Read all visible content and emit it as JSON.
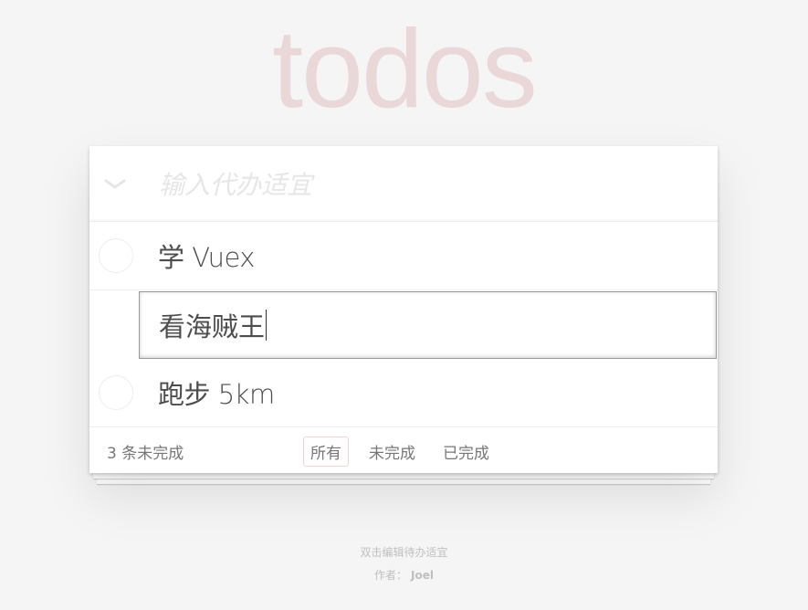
{
  "app": {
    "title": "todos"
  },
  "header": {
    "new_todo_placeholder": "输入代办适宜",
    "toggle_icon": "chevron-down-icon"
  },
  "todos": [
    {
      "title": "学 Vuex",
      "completed": false,
      "editing": false
    },
    {
      "title": "看海贼王",
      "completed": false,
      "editing": true
    },
    {
      "title": "跑步 5km",
      "completed": false,
      "editing": false
    }
  ],
  "footer": {
    "count_text": "3 条未完成",
    "filters": [
      {
        "label": "所有",
        "selected": true
      },
      {
        "label": "未完成",
        "selected": false
      },
      {
        "label": "已完成",
        "selected": false
      }
    ]
  },
  "info": {
    "hint": "双击编辑待办适宜",
    "author_label": "作者：",
    "author_name": "Joel"
  },
  "colors": {
    "title": "#e6d5d5",
    "background": "#f5f5f5",
    "text": "#4d4d4d"
  }
}
